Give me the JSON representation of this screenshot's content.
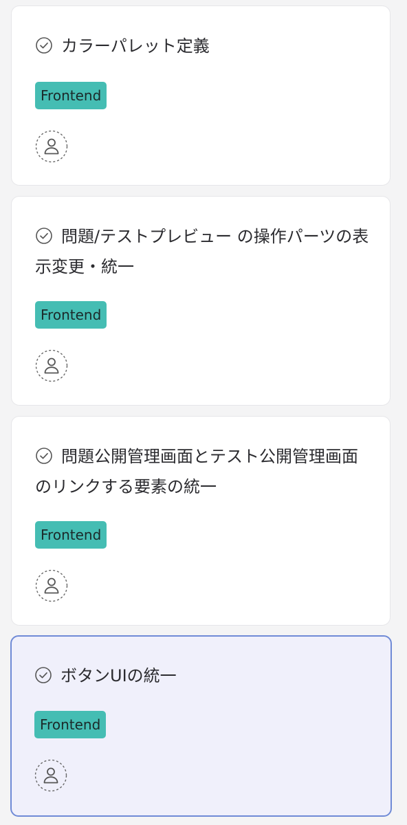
{
  "cards": [
    {
      "title": "カラーパレット定義",
      "tag": "Frontend",
      "selected": false
    },
    {
      "title": "問題/テストプレビュー の操作パーツの表示変更・統一",
      "tag": "Frontend",
      "selected": false
    },
    {
      "title": "問題公開管理画面とテスト公開管理画面のリンクする要素の統一",
      "tag": "Frontend",
      "selected": false
    },
    {
      "title": "ボタンUIの統一",
      "tag": "Frontend",
      "selected": true
    }
  ],
  "colors": {
    "background": "#f4f4f5",
    "card": "#ffffff",
    "selected_card": "#f0f0fb",
    "selected_border": "#6f8ad6",
    "tag": "#45bdb3"
  },
  "icons": {
    "status": "check-circle-icon",
    "assignee": "unassigned-user-icon"
  }
}
